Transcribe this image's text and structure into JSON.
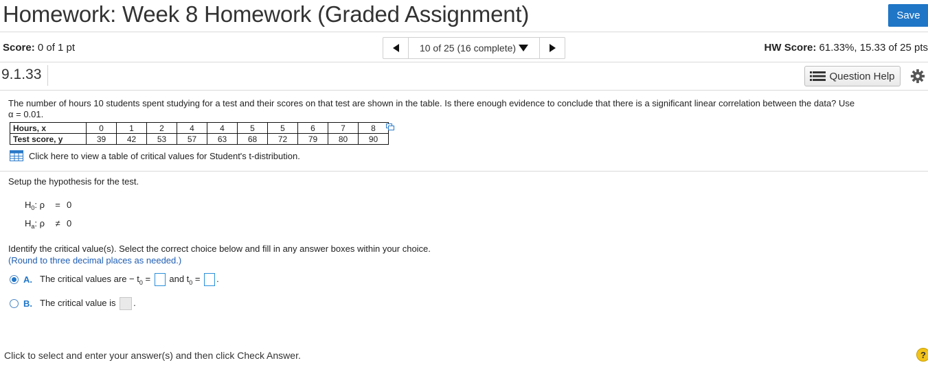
{
  "header": {
    "title": "Homework: Week 8 Homework (Graded Assignment)",
    "save_label": "Save"
  },
  "status": {
    "score_label": "Score:",
    "score_value": "0 of 1 pt",
    "nav_text": "10 of 25 (16 complete)",
    "hw_score_label": "HW Score:",
    "hw_score_value": "61.33%, 15.33 of 25 pts"
  },
  "question": {
    "number": "9.1.33",
    "help_label": "Question Help",
    "text_line1": "The number of hours 10 students spent studying for a test and their scores on that test are shown in the table. Is there enough evidence to conclude that there is a significant linear correlation between the data? Use",
    "text_line2": "α = 0.01.",
    "table": {
      "row1_header": "Hours, x",
      "row1": [
        "0",
        "1",
        "2",
        "4",
        "4",
        "5",
        "5",
        "6",
        "7",
        "8"
      ],
      "row2_header": "Test score, y",
      "row2": [
        "39",
        "42",
        "53",
        "57",
        "63",
        "68",
        "72",
        "79",
        "80",
        "90"
      ]
    },
    "table_link": "Click here to view a table of critical values for Student's t-distribution.",
    "setup_text": "Setup the hypothesis for the test.",
    "h0": {
      "H": "H",
      "sub": "0",
      "rho": ": ρ",
      "op": "=",
      "val": "0"
    },
    "ha": {
      "H": "H",
      "sub": "a",
      "rho": ": ρ",
      "op": "≠",
      "val": "0"
    },
    "identify_text": "Identify the critical value(s). Select the correct choice below and fill in any answer boxes within your choice.",
    "round_text": "(Round to three decimal places as needed.)",
    "choice_a": {
      "letter": "A.",
      "text1": "The critical values are  − t",
      "sub": "0",
      "eq": " =",
      "and": "and t",
      "eq2": " =",
      "end": "."
    },
    "choice_b": {
      "letter": "B.",
      "text1": "The critical value is",
      "end": "."
    }
  },
  "footer": {
    "instruction": "Click to select and enter your answer(s) and then click Check Answer.",
    "help_symbol": "?"
  },
  "colors": {
    "accent": "#1f76c7",
    "help_yellow": "#f2c319"
  }
}
